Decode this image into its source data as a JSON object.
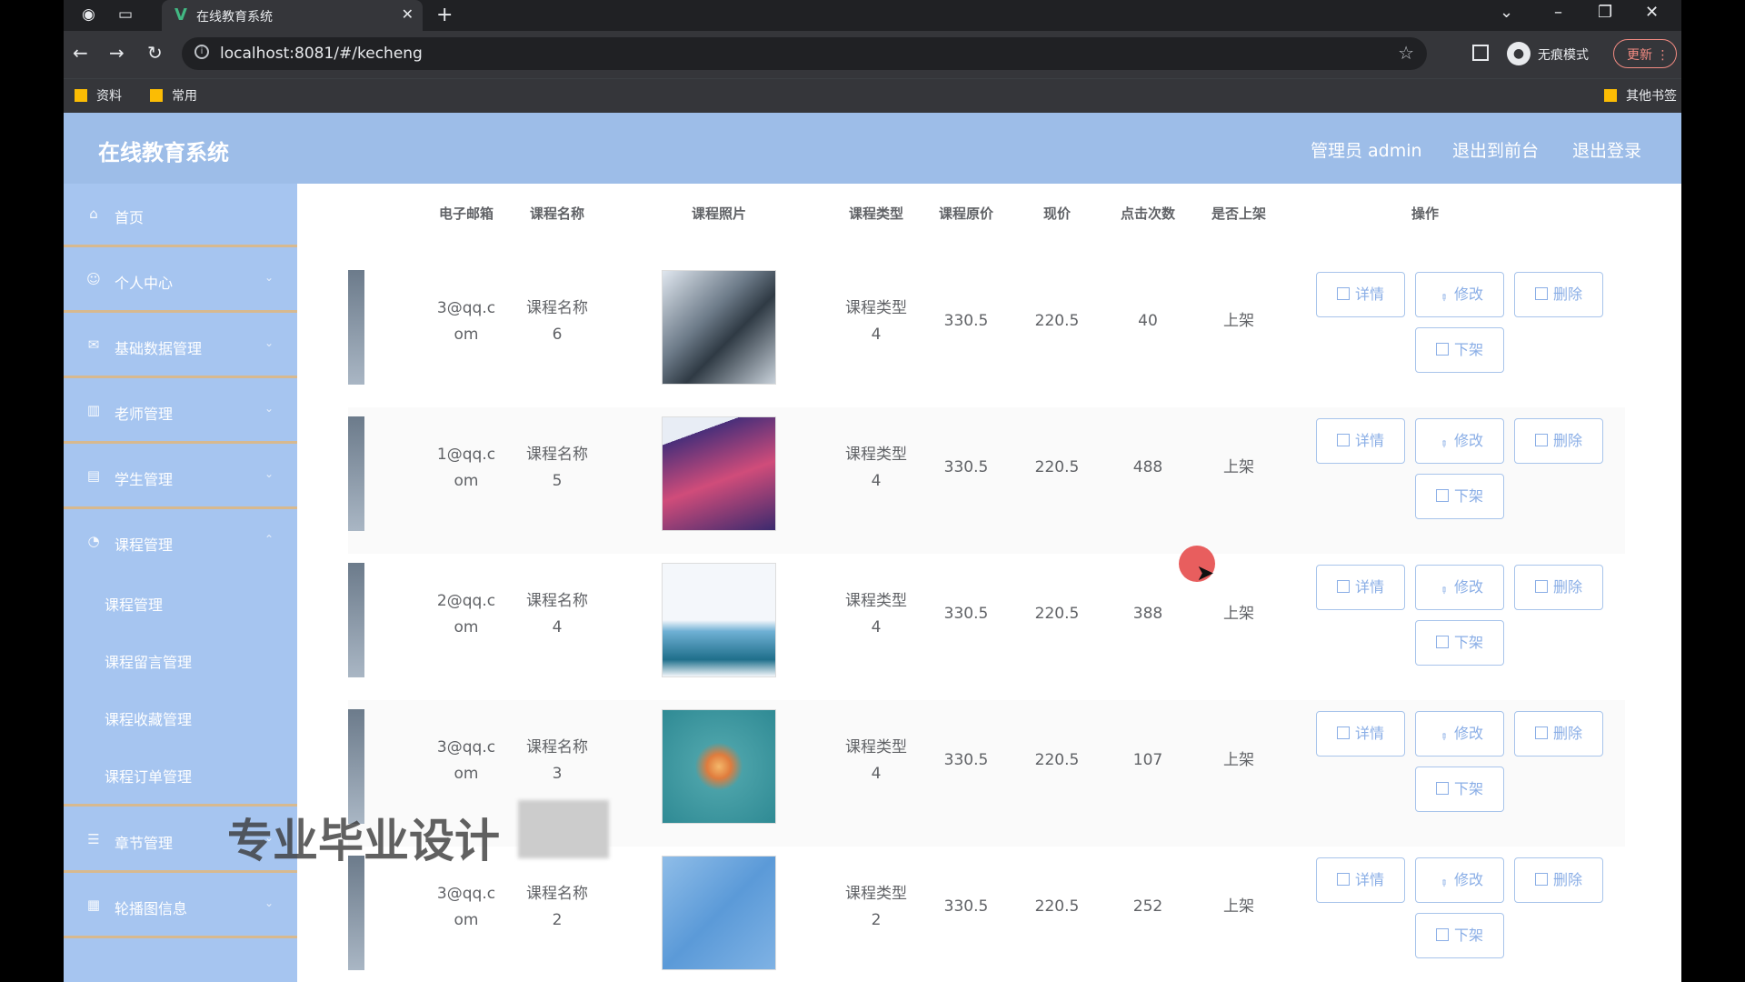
{
  "browser": {
    "tab_title": "在线教育系统",
    "url": "localhost:8081/#/kecheng",
    "profile_label": "无痕模式",
    "update_label": "更新",
    "bookmarks": [
      "资料",
      "常用"
    ],
    "other_bookmarks": "其他书签"
  },
  "header": {
    "title": "在线教育系统",
    "admin_label": "管理员 admin",
    "back_to_front": "退出到前台",
    "logout": "退出登录"
  },
  "sidebar": {
    "items": [
      {
        "label": "首页",
        "icon": "home-icon"
      },
      {
        "label": "个人中心",
        "icon": "user-icon"
      },
      {
        "label": "基础数据管理",
        "icon": "mail-icon"
      },
      {
        "label": "老师管理",
        "icon": "chart-icon"
      },
      {
        "label": "学生管理",
        "icon": "id-card-icon"
      },
      {
        "label": "课程管理",
        "icon": "course-icon"
      }
    ],
    "submenu": [
      "课程管理",
      "课程留言管理",
      "课程收藏管理",
      "课程订单管理"
    ],
    "items_after": [
      {
        "label": "章节管理",
        "icon": "list-icon"
      },
      {
        "label": "轮播图信息",
        "icon": "image-icon"
      }
    ]
  },
  "table": {
    "headers": [
      "电子邮箱",
      "课程名称",
      "课程照片",
      "课程类型",
      "课程原价",
      "现价",
      "点击次数",
      "是否上架",
      "操作"
    ],
    "rows": [
      {
        "email1": "3@qq.c",
        "email2": "om",
        "name1": "课程名称",
        "name2": "6",
        "type1": "课程类型",
        "type2": "4",
        "orig": "330.5",
        "price": "220.5",
        "clicks": "40",
        "status": "上架"
      },
      {
        "email1": "1@qq.c",
        "email2": "om",
        "name1": "课程名称",
        "name2": "5",
        "type1": "课程类型",
        "type2": "4",
        "orig": "330.5",
        "price": "220.5",
        "clicks": "488",
        "status": "上架"
      },
      {
        "email1": "2@qq.c",
        "email2": "om",
        "name1": "课程名称",
        "name2": "4",
        "type1": "课程类型",
        "type2": "4",
        "orig": "330.5",
        "price": "220.5",
        "clicks": "388",
        "status": "上架"
      },
      {
        "email1": "3@qq.c",
        "email2": "om",
        "name1": "课程名称",
        "name2": "3",
        "type1": "课程类型",
        "type2": "4",
        "orig": "330.5",
        "price": "220.5",
        "clicks": "107",
        "status": "上架"
      },
      {
        "email1": "3@qq.c",
        "email2": "om",
        "name1": "课程名称",
        "name2": "2",
        "type1": "课程类型",
        "type2": "2",
        "orig": "330.5",
        "price": "220.5",
        "clicks": "252",
        "status": "上架"
      }
    ],
    "actions": {
      "detail": "详情",
      "edit": "修改",
      "delete": "删除",
      "offline": "下架"
    }
  },
  "overlay": {
    "watermark": "专业毕业设计"
  },
  "colors": {
    "header": "#9dbde8",
    "sidebar": "#a6c5f0",
    "button_border": "#a8c4eb",
    "button_text": "#8aaee6"
  }
}
